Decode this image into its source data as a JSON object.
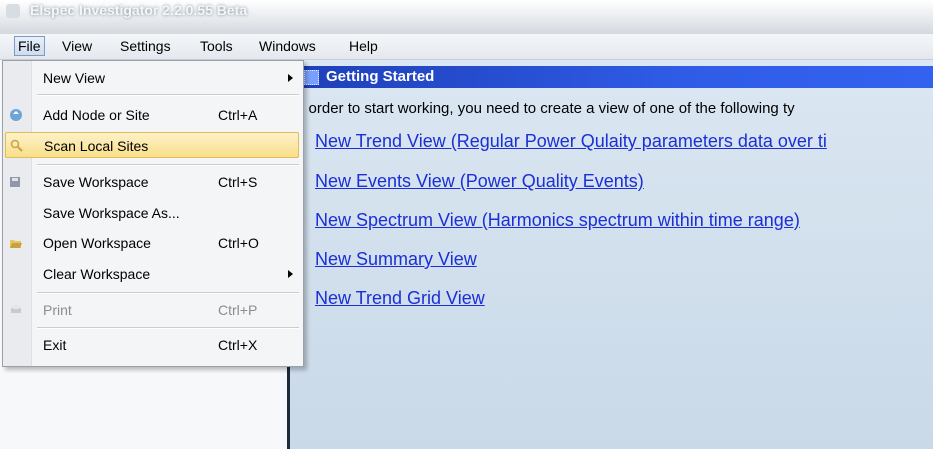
{
  "window": {
    "title": "Elspec Investigator 2.2.0.55 Beta"
  },
  "menubar": {
    "items": [
      {
        "label": "File"
      },
      {
        "label": "View"
      },
      {
        "label": "Settings"
      },
      {
        "label": "Tools"
      },
      {
        "label": "Windows"
      },
      {
        "label": "Help"
      }
    ]
  },
  "file_menu": {
    "items": [
      {
        "label": "New View",
        "shortcut": "",
        "submenu": true
      },
      {
        "label": "Add Node or Site",
        "shortcut": "Ctrl+A",
        "icon": "add-node-icon"
      },
      {
        "label": "Scan Local Sites",
        "shortcut": "",
        "icon": "scan-icon",
        "highlighted": true
      },
      {
        "label": "Save Workspace",
        "shortcut": "Ctrl+S",
        "icon": "save-icon"
      },
      {
        "label": "Save Workspace As...",
        "shortcut": ""
      },
      {
        "label": "Open Workspace",
        "shortcut": "Ctrl+O",
        "icon": "open-folder-icon"
      },
      {
        "label": "Clear Workspace",
        "shortcut": "",
        "submenu": true
      },
      {
        "label": "Print",
        "shortcut": "Ctrl+P",
        "icon": "print-icon",
        "disabled": true
      },
      {
        "label": "Exit",
        "shortcut": "Ctrl+X"
      }
    ]
  },
  "getting_started": {
    "title": "Getting Started",
    "intro": "n order to start working, you need to create a view of one of the following ty",
    "links": [
      "New Trend View (Regular Power Qulaity parameters data over ti",
      "New Events View (Power Quality Events)",
      "New Spectrum View (Harmonics spectrum within time range)",
      "New Summary View",
      "New Trend Grid View"
    ]
  },
  "colors": {
    "header_blue": "#2f5be6",
    "link_blue": "#1a2fd6",
    "highlight": "#f9df8a",
    "content_bg": "#d3e1ee"
  }
}
